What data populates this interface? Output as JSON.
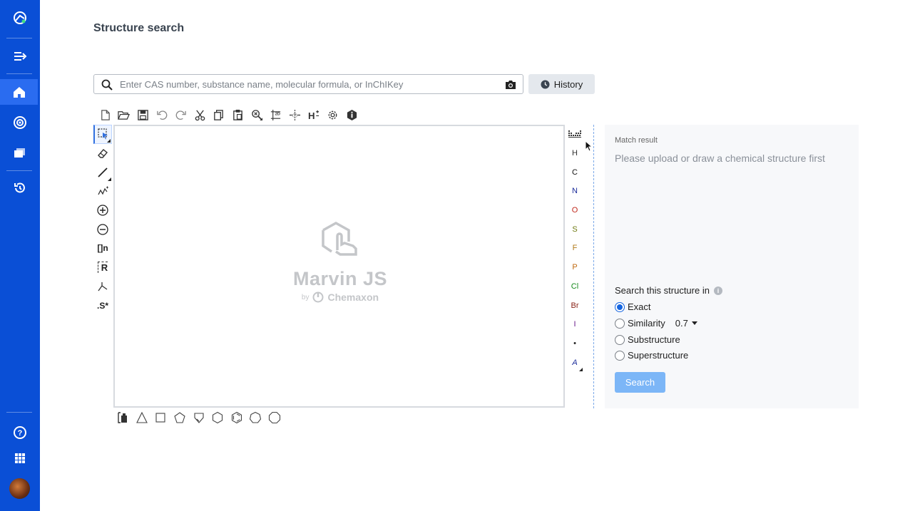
{
  "sidebar": {
    "items": [
      {
        "icon": "app-logo-icon"
      },
      {
        "icon": "expand-menu-icon"
      },
      {
        "icon": "home-icon",
        "active": true
      },
      {
        "icon": "radar-icon"
      },
      {
        "icon": "folders-icon"
      },
      {
        "icon": "history-icon"
      },
      {
        "icon": "help-icon"
      },
      {
        "icon": "apps-grid-icon"
      }
    ],
    "active_color": "#2a6cf0",
    "bg_color": "#0a4fd6"
  },
  "page": {
    "title": "Structure search"
  },
  "search": {
    "placeholder": "Enter CAS number, substance name, molecular formula, or InChIKey",
    "value": "",
    "history_label": "History"
  },
  "editor": {
    "top_tools": [
      "new-document-icon",
      "open-folder-icon",
      "save-icon",
      "undo-icon",
      "redo-icon",
      "cut-icon",
      "copy-icon",
      "paste-icon",
      "zoom-icon",
      "clean-2d-icon",
      "aromatize-icon",
      "hydrogens-icon",
      "settings-icon",
      "info-icon"
    ],
    "left_tools": [
      "select-icon",
      "eraser-icon",
      "single-bond-icon",
      "chain-icon",
      "positive-charge-icon",
      "negative-charge-icon",
      "sgroup-icon",
      "rgroup-icon",
      "reaction-arrow-icon",
      "stereo-icon"
    ],
    "left_text": {
      "sgroup": "[]n",
      "rgroup": "R",
      "stereo": ".S*"
    },
    "atoms": [
      {
        "symbol": "H",
        "color": "#333333"
      },
      {
        "symbol": "C",
        "color": "#111111"
      },
      {
        "symbol": "N",
        "color": "#1a2b9a"
      },
      {
        "symbol": "O",
        "color": "#c0281c"
      },
      {
        "symbol": "S",
        "color": "#6e7a12"
      },
      {
        "symbol": "F",
        "color": "#b07a18"
      },
      {
        "symbol": "P",
        "color": "#c06a10"
      },
      {
        "symbol": "Cl",
        "color": "#168a1c"
      },
      {
        "symbol": "Br",
        "color": "#8a2418"
      },
      {
        "symbol": "I",
        "color": "#6a1a8a"
      },
      {
        "symbol": "•",
        "color": "#222222"
      },
      {
        "symbol": "A",
        "color": "#1a2b9a"
      }
    ],
    "bottom_tools": [
      "template-library-icon",
      "cyclopropane-icon",
      "cyclobutane-icon",
      "cyclopentane-icon",
      "cyclopentane-house-icon",
      "cyclohexane-icon",
      "benzene-icon",
      "cycloheptane-icon",
      "cyclooctane-icon"
    ],
    "logo": {
      "name": "Marvin JS",
      "by": "by",
      "brand": "Chemaxon"
    }
  },
  "result": {
    "label": "Match result",
    "message": "Please upload or draw a chemical structure first",
    "search_in_label": "Search this structure in",
    "options": [
      {
        "label": "Exact",
        "checked": true
      },
      {
        "label": "Similarity",
        "checked": false
      },
      {
        "label": "Substructure",
        "checked": false
      },
      {
        "label": "Superstructure",
        "checked": false
      }
    ],
    "similarity_value": "0.7",
    "search_button": "Search",
    "accent": "#1565e0",
    "button_color": "#7cb6f7"
  }
}
